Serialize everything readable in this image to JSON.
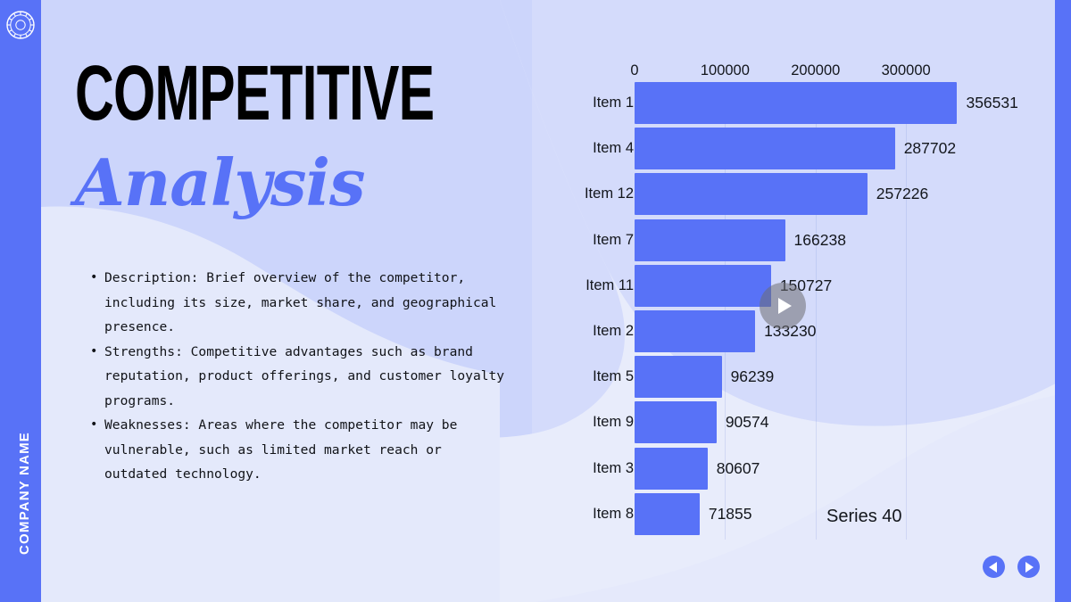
{
  "sidebar": {
    "company_name": "COMPANY NAME",
    "logo_icon": "sunburst-circle-logo",
    "color": "#5872f7"
  },
  "title": {
    "line1": "COMPETITIVE",
    "line2": "Analysis",
    "line1_color": "#000000",
    "line2_color": "#5872f7"
  },
  "bullets": [
    "Description: Brief overview of the competitor, including its size, market share, and geographical presence.",
    "Strengths: Competitive advantages such as brand reputation, product offerings, and customer loyalty programs.",
    "Weaknesses: Areas where the competitor may be vulnerable, such as limited market reach or outdated technology."
  ],
  "controls": {
    "play_icon": "play-triangle-icon",
    "prev_icon": "chevron-left-icon",
    "next_icon": "chevron-right-icon"
  },
  "theme": {
    "background": "#e8ecfb",
    "blob_light": "#e4e9fb",
    "blob_mid": "#ccd5fb",
    "accent": "#5872f7"
  },
  "chart_data": {
    "type": "bar",
    "orientation": "horizontal",
    "title": "",
    "xlabel": "",
    "ylabel": "",
    "legend": "Series 40",
    "legend_position": "bottom-right",
    "grid": true,
    "xlim": [
      0,
      360000
    ],
    "xticks": [
      0,
      100000,
      200000,
      300000
    ],
    "xtick_labels": [
      "0",
      "100000",
      "200000",
      "300000"
    ],
    "categories": [
      "Item 1",
      "Item 4",
      "Item 12",
      "Item 7",
      "Item 11",
      "Item 2",
      "Item 5",
      "Item 9",
      "Item 3",
      "Item 8"
    ],
    "values": [
      356531,
      287702,
      257226,
      166238,
      150727,
      133230,
      96239,
      90574,
      80607,
      71855
    ],
    "value_labels": [
      "356531",
      "287702",
      "257226",
      "166238",
      "150727",
      "133230",
      "96239",
      "90574",
      "80607",
      "71855"
    ],
    "bar_color": "#5872f7",
    "series": [
      {
        "name": "Series 40",
        "values": [
          356531,
          287702,
          257226,
          166238,
          150727,
          133230,
          96239,
          90574,
          80607,
          71855
        ]
      }
    ]
  }
}
